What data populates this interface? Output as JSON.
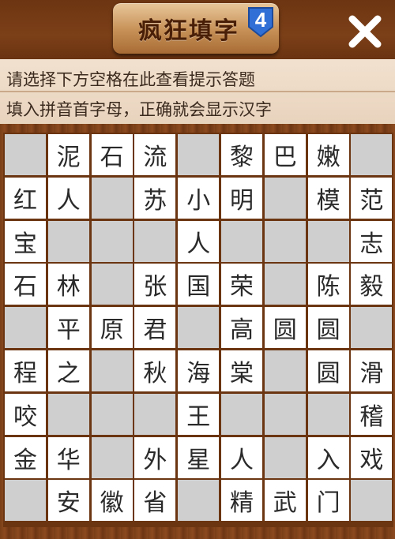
{
  "header": {
    "logo_title": "疯狂填字",
    "level": "4",
    "close_icon": "close-icon"
  },
  "hints": {
    "line1": "请选择下方空格在此查看提示答题",
    "line2": "填入拼音首字母，正确就会显示汉字"
  },
  "board": {
    "rows": [
      [
        "",
        "泥",
        "石",
        "流",
        "",
        "黎",
        "巴",
        "嫩",
        ""
      ],
      [
        "红",
        "人",
        "",
        "苏",
        "小",
        "明",
        "",
        "模",
        "范"
      ],
      [
        "宝",
        "",
        "",
        "",
        "人",
        "",
        "",
        "",
        "志"
      ],
      [
        "石",
        "林",
        "",
        "张",
        "国",
        "荣",
        "",
        "陈",
        "毅"
      ],
      [
        "",
        "平",
        "原",
        "君",
        "",
        "高",
        "圆",
        "圆",
        ""
      ],
      [
        "程",
        "之",
        "",
        "秋",
        "海",
        "棠",
        "",
        "圆",
        "滑"
      ],
      [
        "咬",
        "",
        "",
        "",
        "王",
        "",
        "",
        "",
        "稽"
      ],
      [
        "金",
        "华",
        "",
        "外",
        "星",
        "人",
        "",
        "入",
        "戏"
      ],
      [
        "",
        "安",
        "徽",
        "省",
        "",
        "精",
        "武",
        "门",
        ""
      ]
    ]
  },
  "colors": {
    "filled_cell": "#ffffff",
    "empty_cell": "#cfcfcf",
    "board_frame": "#6b3511"
  }
}
